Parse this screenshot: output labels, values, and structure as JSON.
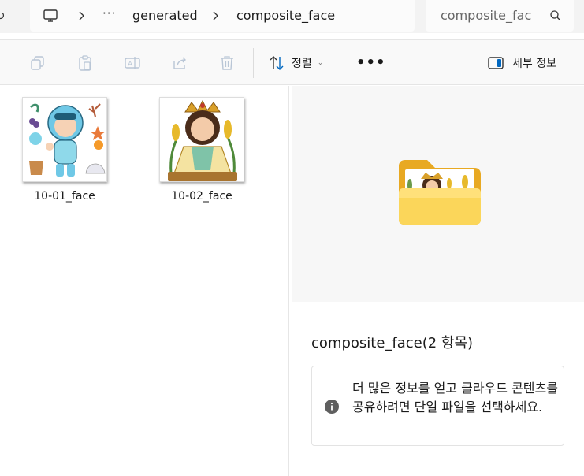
{
  "address_bar": {
    "breadcrumbs": [
      "generated",
      "composite_face"
    ],
    "more_label": "···"
  },
  "search": {
    "value": "composite_fac"
  },
  "toolbar": {
    "sort_label": "정렬",
    "more_label": "•••",
    "details_label": "세부 정보"
  },
  "files": [
    {
      "name": "10-01_face"
    },
    {
      "name": "10-02_face"
    }
  ],
  "details": {
    "title": "composite_face(2 항목)",
    "info_text": "더 많은 정보를 얻고 클라우드 콘텐츠를 공유하려면 단일 파일을 선택하세요."
  },
  "colors": {
    "accent": "#0067c0",
    "folder": "#f7c948",
    "toolbar_bg": "#f9f9f9",
    "address_bg": "#f3f3f3"
  }
}
